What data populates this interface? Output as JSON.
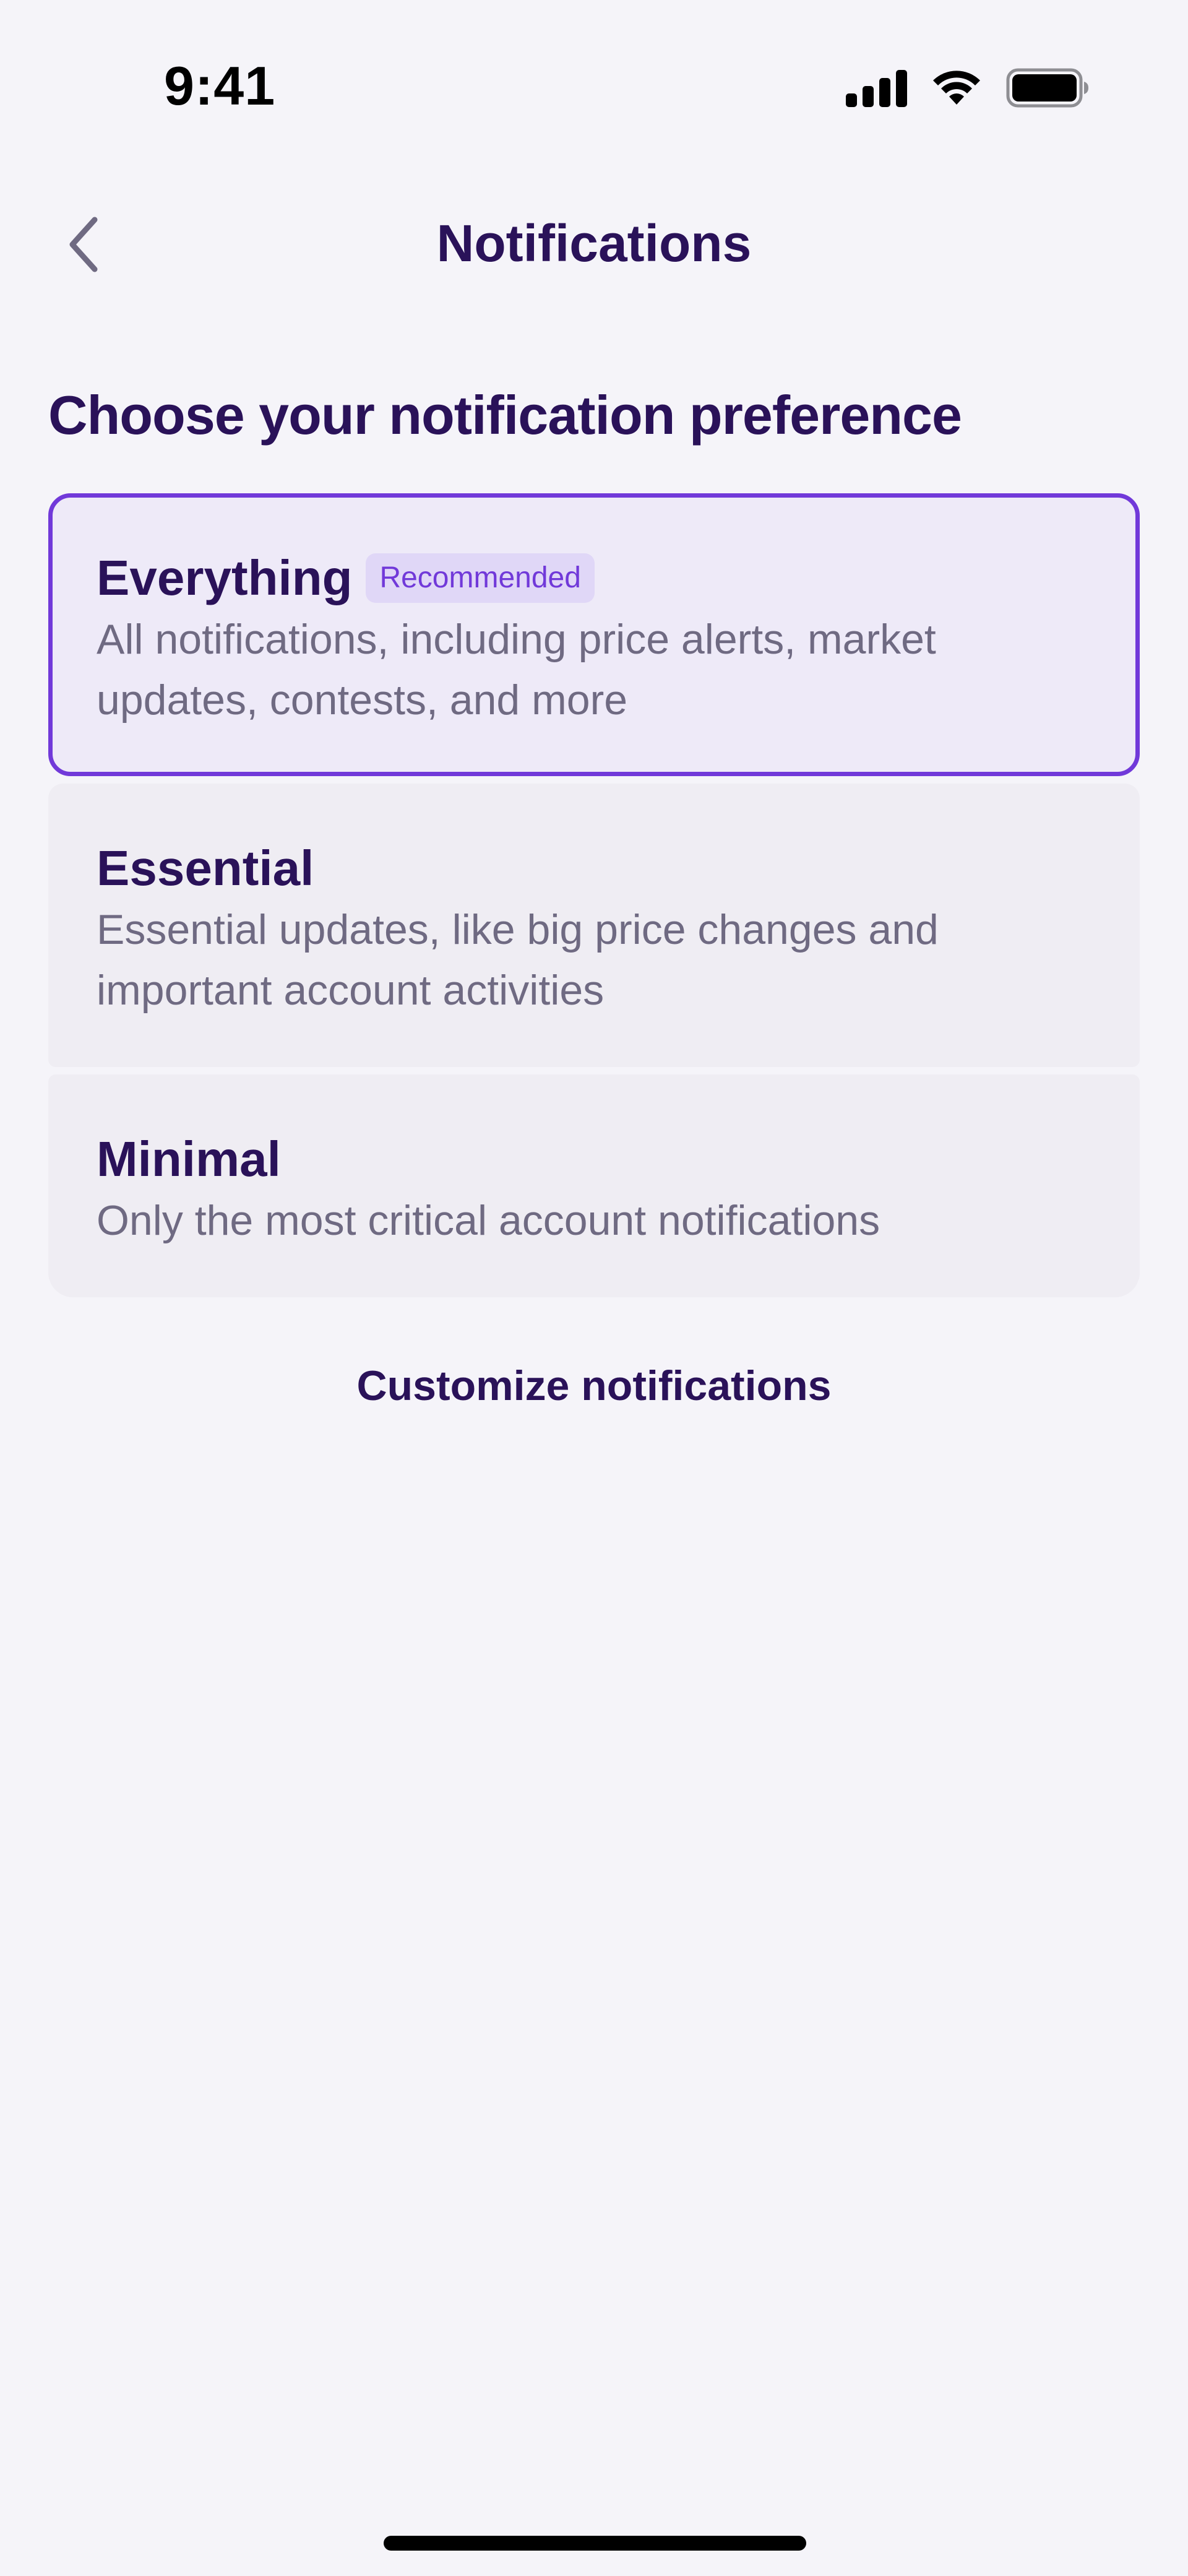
{
  "status_bar": {
    "time": "9:41",
    "signal_icon": "cellular-signal-icon",
    "wifi_icon": "wifi-icon",
    "battery_icon": "battery-icon"
  },
  "header": {
    "back_icon": "chevron-left-icon",
    "title": "Notifications"
  },
  "section_heading": "Choose your notification preference",
  "options": [
    {
      "title": "Everything",
      "badge": "Recommended",
      "description": "All notifications, including price alerts, market updates, contests, and more",
      "selected": true
    },
    {
      "title": "Essential",
      "description": "Essential updates, like big price changes and important account activities",
      "selected": false
    },
    {
      "title": "Minimal",
      "description": "Only the most critical account notifications",
      "selected": false
    }
  ],
  "customize_link": "Customize notifications",
  "colors": {
    "background": "#f5f4f9",
    "primary_text": "#2a1259",
    "accent": "#7139d9",
    "secondary_text": "#6f6a82",
    "card_background": "#efedf3",
    "selected_card_background": "#eeeaf8"
  }
}
